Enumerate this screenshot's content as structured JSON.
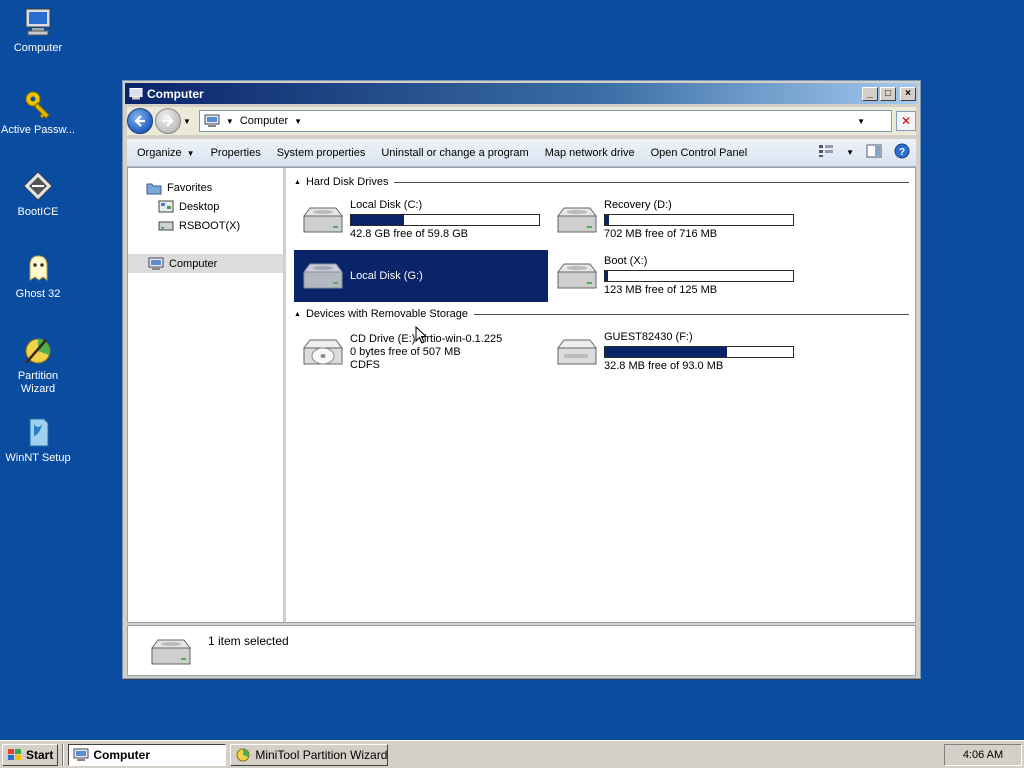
{
  "desktop": {
    "icons": [
      {
        "label": "Computer",
        "icon": "computer-icon"
      },
      {
        "label": "Active Passw...",
        "icon": "key-icon"
      },
      {
        "label": "BootICE",
        "icon": "bootice-icon"
      },
      {
        "label": "Ghost 32",
        "icon": "ghost-icon"
      },
      {
        "label": "Partition Wizard",
        "icon": "partition-wizard-icon"
      },
      {
        "label": "WinNT Setup",
        "icon": "winnt-setup-icon"
      }
    ]
  },
  "window": {
    "title": "Computer",
    "address": {
      "location": "Computer"
    },
    "commands": {
      "organize": "Organize",
      "properties": "Properties",
      "system_properties": "System properties",
      "uninstall": "Uninstall or change a program",
      "map_drive": "Map network drive",
      "control_panel": "Open Control Panel"
    },
    "navpane": {
      "favorites": "Favorites",
      "desktop": "Desktop",
      "rsboot": "RSBOOT(X)",
      "computer": "Computer"
    },
    "groups": {
      "hard_disks": "Hard Disk Drives",
      "removable": "Devices with Removable Storage"
    },
    "drives": {
      "c": {
        "name": "Local Disk (C:)",
        "free": "42.8 GB free of 59.8 GB",
        "used_fraction": 0.28
      },
      "d": {
        "name": "Recovery (D:)",
        "free": "702 MB free of 716 MB",
        "used_fraction": 0.02
      },
      "g": {
        "name": "Local Disk (G:)"
      },
      "x": {
        "name": "Boot (X:)",
        "free": "123 MB free of 125 MB",
        "used_fraction": 0.016
      },
      "e": {
        "name": "CD Drive (E:) virtio-win-0.1.225",
        "free": "0 bytes free of 507 MB",
        "fs": "CDFS"
      },
      "f": {
        "name": "GUEST82430 (F:)",
        "free": "32.8 MB free of 93.0 MB",
        "used_fraction": 0.647
      }
    },
    "details": {
      "selection": "1 item selected"
    }
  },
  "taskbar": {
    "start": "Start",
    "tasks": [
      "Computer",
      "MiniTool Partition Wizard ..."
    ],
    "clock": "4:06 AM"
  },
  "colors": {
    "desktop": "#0a4da0",
    "selection": "#0a246a",
    "usage_bar": "#0a246a"
  }
}
